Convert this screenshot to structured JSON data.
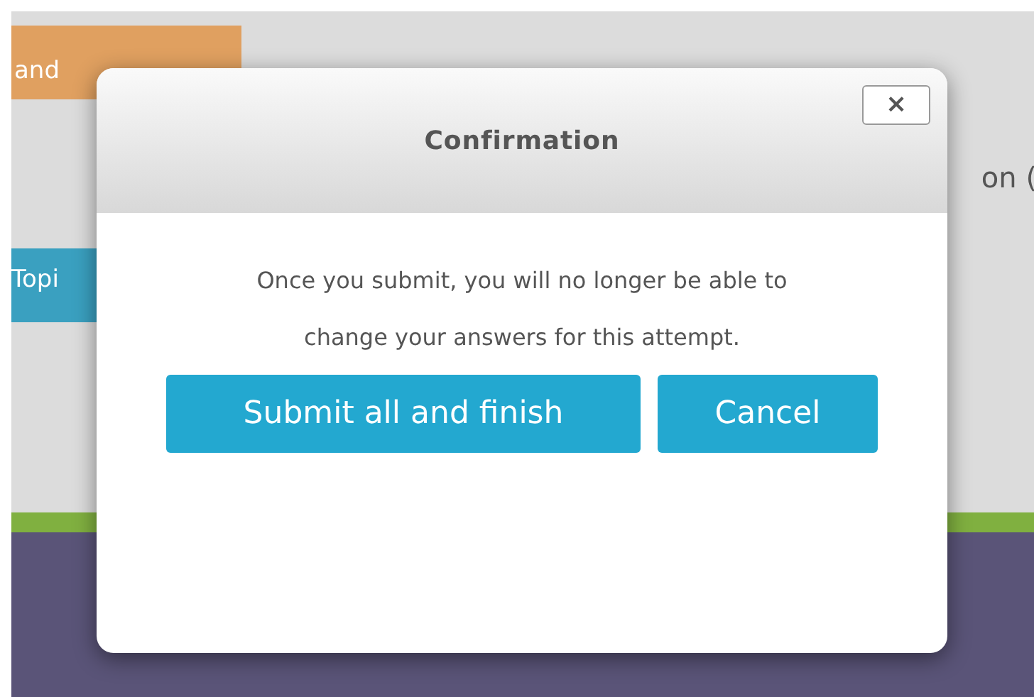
{
  "background": {
    "finish_button": "and",
    "topic_button": "Topi",
    "side_text": "on ("
  },
  "dialog": {
    "title": "Confirmation",
    "close": "×",
    "message": "Once you submit, you will no longer be able to change your answers for this attempt.",
    "buttons": [
      {
        "label": "Submit all and finish"
      },
      {
        "label": "Cancel"
      }
    ]
  }
}
